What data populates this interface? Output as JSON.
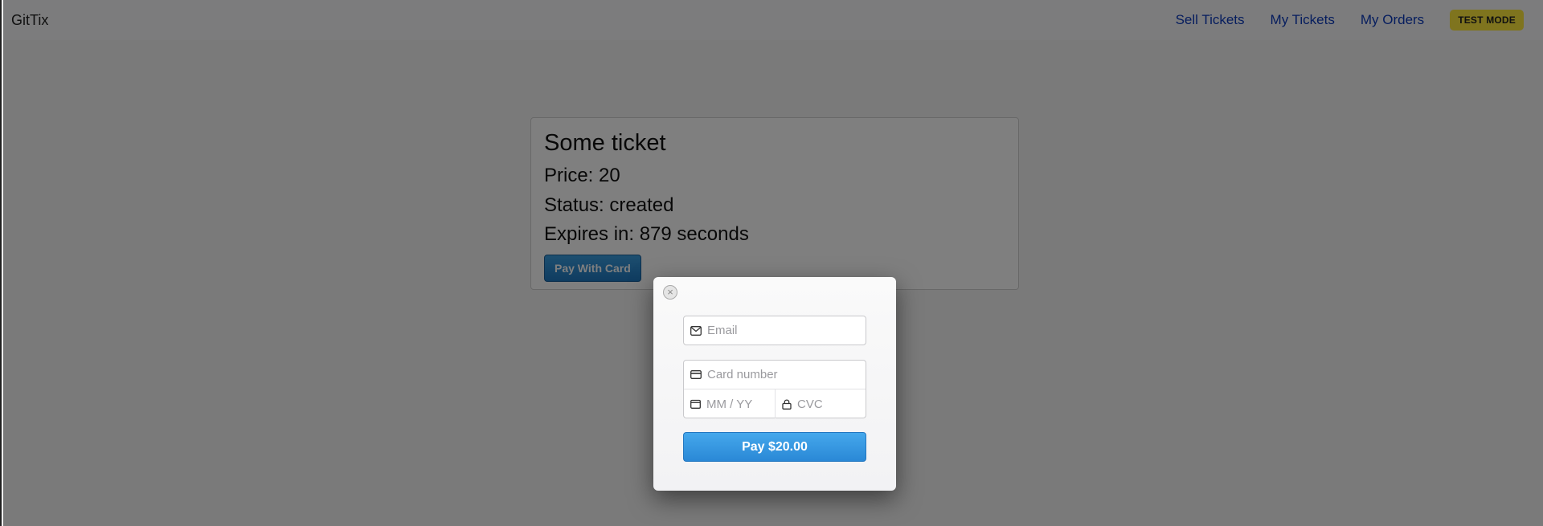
{
  "navbar": {
    "brand": "GitTix",
    "links": [
      "Sell Tickets",
      "My Tickets",
      "My Orders"
    ]
  },
  "test_mode_badge": "TEST MODE",
  "ticket": {
    "title": "Some ticket",
    "price": "Price: 20",
    "status": "Status: created",
    "expires": "Expires in: 879 seconds",
    "pay_button": "Pay With Card"
  },
  "checkout": {
    "close_icon": "close-icon",
    "email_placeholder": "Email",
    "card_number_placeholder": "Card number",
    "expiry_placeholder": "MM / YY",
    "cvc_placeholder": "CVC",
    "submit_label": "Pay $20.00"
  },
  "colors": {
    "link": "#0d3bbd",
    "badge": "#ffe83d",
    "pay_button": "#2a88d6"
  }
}
